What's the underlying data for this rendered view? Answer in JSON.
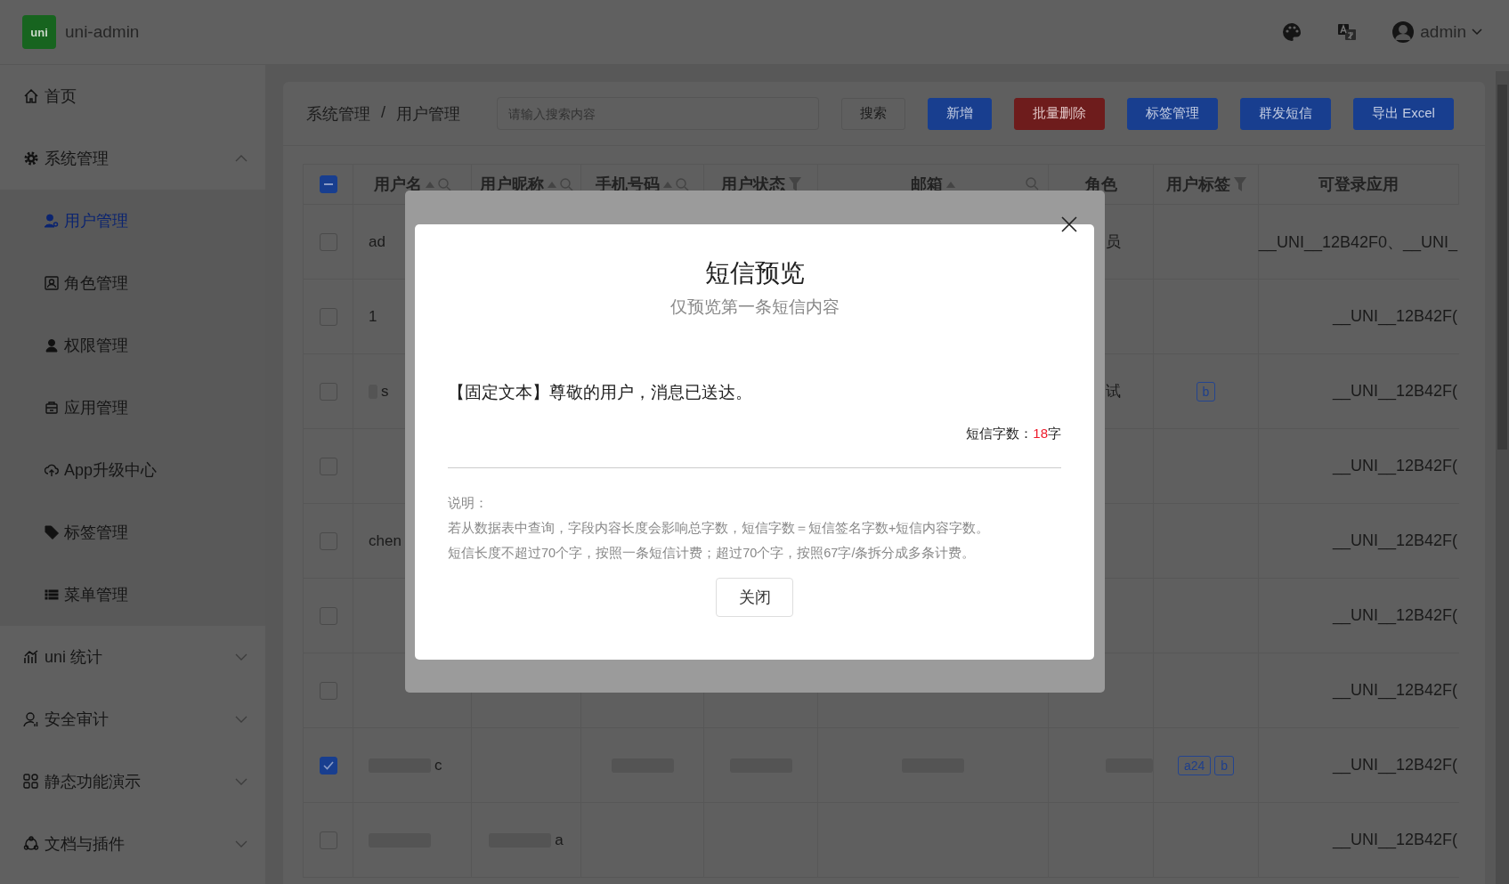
{
  "topbar": {
    "logo": "uni",
    "title": "uni-admin",
    "user": "admin"
  },
  "sidebar": {
    "items": [
      {
        "label": "首页",
        "kind": "link",
        "selected": false
      },
      {
        "label": "系统管理",
        "kind": "group",
        "expanded": true,
        "children": [
          {
            "label": "用户管理",
            "selected": true
          },
          {
            "label": "角色管理",
            "selected": false
          },
          {
            "label": "权限管理",
            "selected": false
          },
          {
            "label": "应用管理",
            "selected": false
          },
          {
            "label": "App升级中心",
            "selected": false
          },
          {
            "label": "标签管理",
            "selected": false
          },
          {
            "label": "菜单管理",
            "selected": false
          }
        ]
      },
      {
        "label": "uni 统计",
        "kind": "group",
        "expanded": false
      },
      {
        "label": "安全审计",
        "kind": "group",
        "expanded": false
      },
      {
        "label": "静态功能演示",
        "kind": "group",
        "expanded": false
      },
      {
        "label": "文档与插件",
        "kind": "group",
        "expanded": false
      }
    ]
  },
  "breadcrumb": {
    "items": [
      "系统管理",
      "用户管理"
    ],
    "separator": "/"
  },
  "search": {
    "placeholder": "请输入搜索内容"
  },
  "buttons": [
    {
      "label": "搜索",
      "kind": "plain"
    },
    {
      "label": "新增",
      "kind": "primary"
    },
    {
      "label": "批量删除",
      "kind": "danger"
    },
    {
      "label": "标签管理",
      "kind": "primary"
    },
    {
      "label": "群发短信",
      "kind": "primary"
    },
    {
      "label": "导出 Excel",
      "kind": "primary"
    }
  ],
  "table": {
    "header_checkbox": {
      "indeterminate": true
    },
    "columns": [
      {
        "label": "用户名",
        "tools": [
          {
            "kind": "sort"
          },
          {
            "kind": "search"
          }
        ]
      },
      {
        "label": "用户昵称",
        "tools": [
          {
            "kind": "sort"
          },
          {
            "kind": "search"
          }
        ]
      },
      {
        "label": "手机号码",
        "tools": [
          {
            "kind": "sort"
          },
          {
            "kind": "search"
          }
        ]
      },
      {
        "label": "用户状态",
        "tools": [
          {
            "kind": "filter"
          }
        ]
      },
      {
        "label": "邮箱",
        "tools": [
          {
            "kind": "sort"
          },
          {
            "kind": "search"
          }
        ]
      },
      {
        "label": "角色"
      },
      {
        "label": "用户标签",
        "tools": [
          {
            "kind": "filter"
          }
        ]
      },
      {
        "label": "可登录应用"
      }
    ],
    "rows": [
      {
        "checked": false,
        "username": "ad",
        "role": "员",
        "apps": "__UNI__12B42F0、__UNI_"
      },
      {
        "checked": false,
        "username": "1",
        "apps": "__UNI__12B42F("
      },
      {
        "checked": false,
        "username": {
          "text": "s",
          "redacted": true
        },
        "role": "试",
        "tags": [
          "b"
        ],
        "apps": "__UNI__12B42F("
      },
      {
        "checked": false,
        "apps": "__UNI__12B42F("
      },
      {
        "checked": false,
        "username": "chen",
        "apps": "__UNI__12B42F("
      },
      {
        "checked": false,
        "apps": "__UNI__12B42F("
      },
      {
        "checked": false,
        "apps": "__UNI__12B42F("
      },
      {
        "checked": true,
        "username": {
          "text": "c",
          "redacted": true
        },
        "phone": {
          "redacted": true
        },
        "status": {
          "redacted": true
        },
        "email": {
          "redacted": true
        },
        "role": {
          "redacted": true
        },
        "tags": [
          "a24",
          "b"
        ],
        "apps": "__UNI__12B42F("
      },
      {
        "checked": false,
        "username": {
          "redacted": true
        },
        "nickname": {
          "text": "a",
          "redacted": true
        },
        "apps": "__UNI__12B42F("
      }
    ]
  },
  "dialog": {
    "title": "短信预览",
    "subtitle": "仅预览第一条短信内容",
    "message": "【固定文本】尊敬的用户，消息已送达。",
    "count_label": "短信字数：",
    "count": "18",
    "count_unit": "字",
    "note_title": "说明：",
    "notes": [
      "若从数据表中查询，字段内容长度会影响总字数，短信字数＝短信签名字数+短信内容字数。",
      "短信长度不超过70个字，按照一条短信计费；超过70个字，按照67字/条拆分成多条计费。"
    ],
    "close_button": "关闭"
  }
}
